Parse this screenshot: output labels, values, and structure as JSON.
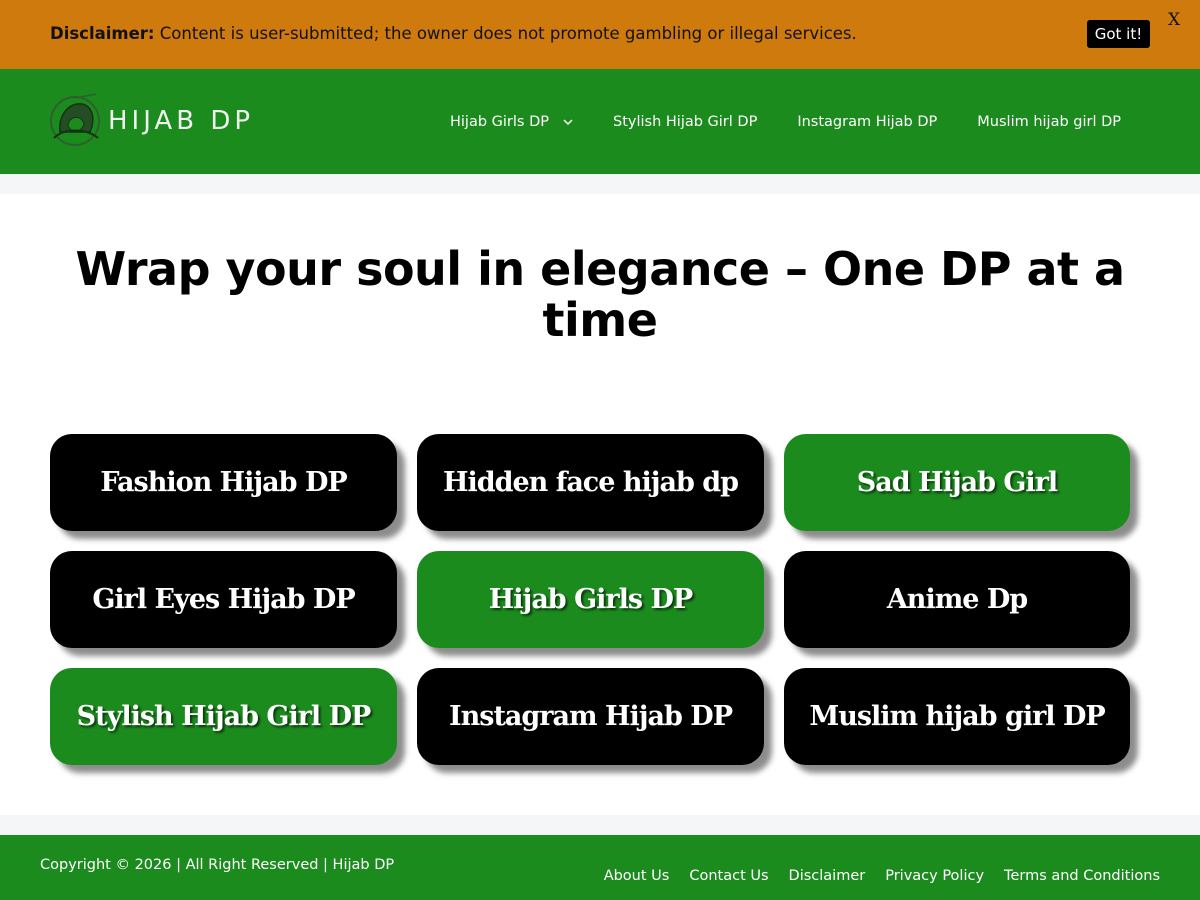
{
  "disclaimer": {
    "label": "Disclaimer:",
    "text": "Content is user-submitted; the owner does not promote gambling or illegal services.",
    "accept_label": "Got it!",
    "close_label": "X"
  },
  "header": {
    "logo_text": "HIJAB DP",
    "nav": [
      {
        "label": "Hijab Girls DP",
        "has_dropdown": true
      },
      {
        "label": "Stylish Hijab Girl DP"
      },
      {
        "label": "Instagram Hijab DP"
      },
      {
        "label": "Muslim hijab girl DP"
      }
    ]
  },
  "main": {
    "title": "Wrap your soul in elegance – One DP at a time",
    "buttons": [
      {
        "label": "Fashion Hijab DP",
        "color": "#000000"
      },
      {
        "label": "Hidden face hijab dp",
        "color": "#000000"
      },
      {
        "label": "Sad Hijab Girl",
        "color": "#1b8b1e"
      },
      {
        "label": "Girl Eyes Hijab DP",
        "color": "#000000"
      },
      {
        "label": "Hijab Girls DP",
        "color": "#1b8b1e"
      },
      {
        "label": "Anime Dp",
        "color": "#000000"
      },
      {
        "label": "Stylish Hijab Girl DP",
        "color": "#1b8b1e"
      },
      {
        "label": "Instagram Hijab DP",
        "color": "#000000"
      },
      {
        "label": "Muslim hijab girl DP",
        "color": "#000000"
      }
    ]
  },
  "footer": {
    "copyright": "Copyright © 2026 | All Right Reserved | Hijab DP",
    "links": [
      {
        "label": "About Us"
      },
      {
        "label": "Contact Us"
      },
      {
        "label": "Disclaimer"
      },
      {
        "label": "Privacy Policy"
      },
      {
        "label": "Terms and Conditions"
      }
    ]
  },
  "colors": {
    "disclaimer_bg": "#cf7a0c",
    "brand_green": "#1b8b1e",
    "button_black": "#000000"
  }
}
